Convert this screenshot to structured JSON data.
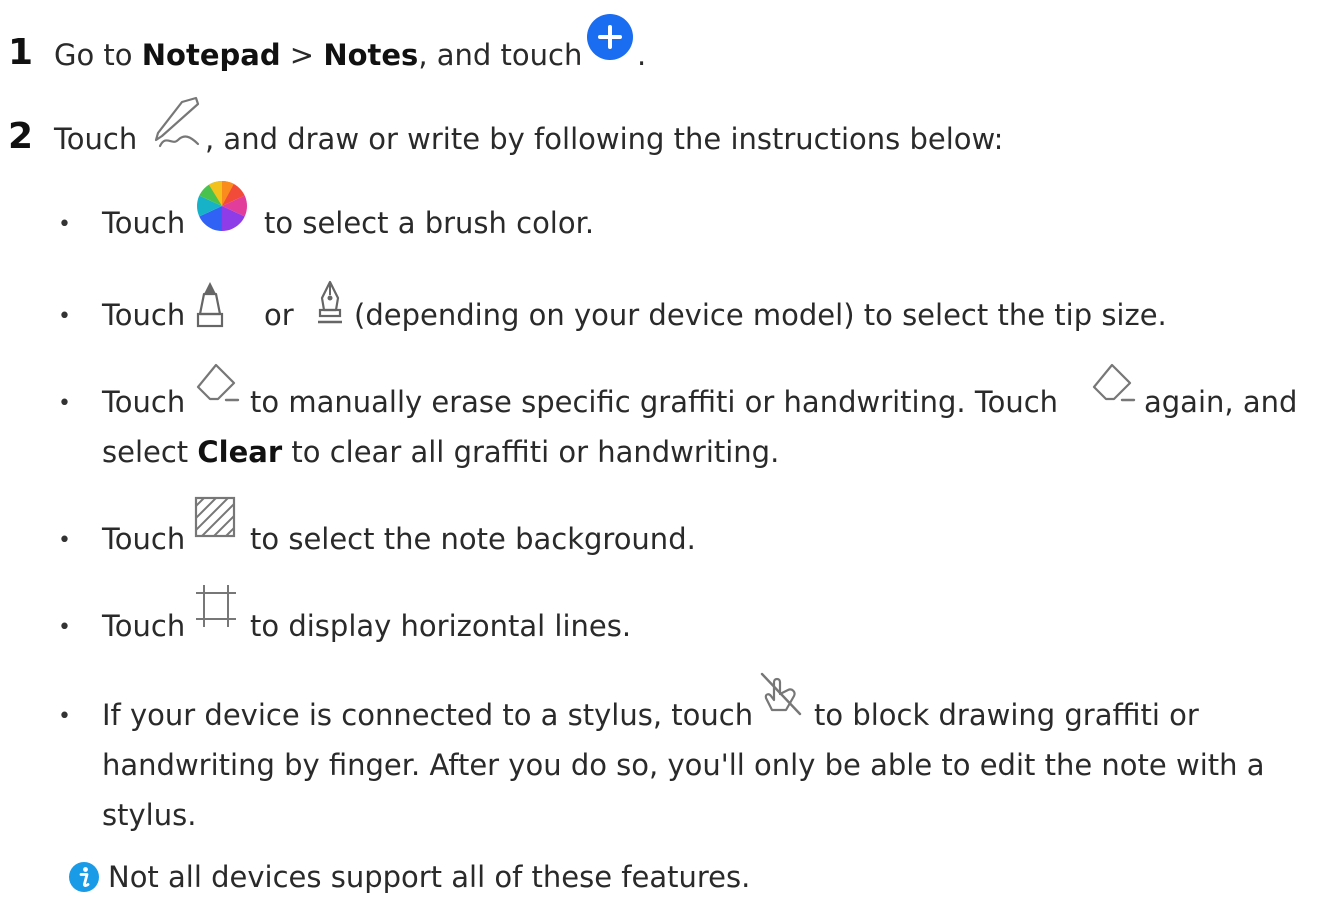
{
  "step1": {
    "number": "1",
    "text_go_to": "Go to",
    "notepad": "Notepad",
    "sep": ">",
    "notes": "Notes",
    "text_and_touch": ", and touch",
    "period": ".",
    "icon": "add-circle-icon",
    "accent": "#1a6cf0"
  },
  "step2": {
    "number": "2",
    "touch": "Touch",
    "text_after_icon": ", and draw or write by following the instructions below:",
    "icon": "handwriting-icon"
  },
  "bullets": [
    {
      "touch": "Touch",
      "after": "to select a brush color.",
      "icon": "color-wheel-icon"
    },
    {
      "touch": "Touch",
      "or": "or",
      "after": "(depending on your device model) to select the tip size.",
      "icons": [
        "pencil-tip-icon",
        "pen-nib-icon"
      ]
    },
    {
      "touch": "Touch",
      "after_first": "to manually erase specific graffiti or handwriting. Touch",
      "after_second": "again, and",
      "line2_select": "select",
      "line2_clear": "Clear",
      "line2_rest": "to clear all graffiti or handwriting.",
      "icon": "eraser-icon"
    },
    {
      "touch": "Touch",
      "after": "to select the note background.",
      "icon": "background-pattern-icon"
    },
    {
      "touch": "Touch",
      "after": "to display horizontal lines.",
      "icon": "horizontal-lines-icon"
    },
    {
      "before": "If your device is connected to a stylus, touch",
      "after": "to block drawing graffiti or",
      "line2": "handwriting by finger. After you do so, you'll only be able to edit the note with a",
      "line3": "stylus.",
      "icon": "finger-block-icon"
    }
  ],
  "note": {
    "text": "Not all devices support all of these features.",
    "icon": "info-icon",
    "accent": "#1a9be8"
  }
}
